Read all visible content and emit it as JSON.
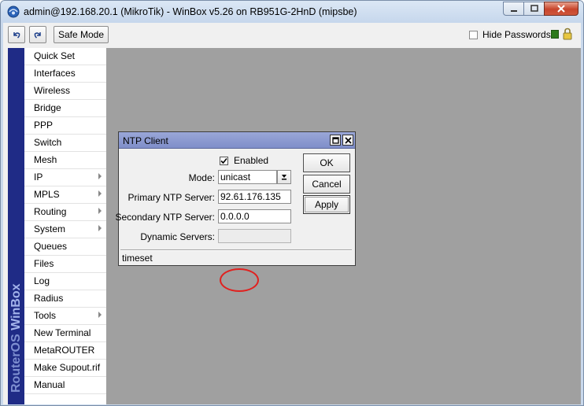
{
  "window": {
    "title": "admin@192.168.20.1 (MikroTik) - WinBox v5.26 on RB951G-2HnD (mipsbe)"
  },
  "toolbar": {
    "undo_icon": "undo-icon",
    "redo_icon": "redo-icon",
    "safe_mode_label": "Safe Mode",
    "hide_passwords_label": "Hide Passwords",
    "hide_passwords_checked": false,
    "status_color": "#2d7a1c"
  },
  "sidebar": {
    "brand": {
      "part1": "RouterOS ",
      "part2": "WinBox"
    },
    "brand_color": "#1f2b86",
    "items": [
      {
        "label": "Quick Set",
        "submenu": false
      },
      {
        "label": "Interfaces",
        "submenu": false
      },
      {
        "label": "Wireless",
        "submenu": false
      },
      {
        "label": "Bridge",
        "submenu": false
      },
      {
        "label": "PPP",
        "submenu": false
      },
      {
        "label": "Switch",
        "submenu": false
      },
      {
        "label": "Mesh",
        "submenu": false
      },
      {
        "label": "IP",
        "submenu": true
      },
      {
        "label": "MPLS",
        "submenu": true
      },
      {
        "label": "Routing",
        "submenu": true
      },
      {
        "label": "System",
        "submenu": true
      },
      {
        "label": "Queues",
        "submenu": false
      },
      {
        "label": "Files",
        "submenu": false
      },
      {
        "label": "Log",
        "submenu": false
      },
      {
        "label": "Radius",
        "submenu": false
      },
      {
        "label": "Tools",
        "submenu": true
      },
      {
        "label": "New Terminal",
        "submenu": false
      },
      {
        "label": "MetaROUTER",
        "submenu": false
      },
      {
        "label": "Make Supout.rif",
        "submenu": false
      },
      {
        "label": "Manual",
        "submenu": false
      }
    ]
  },
  "ntp_dialog": {
    "title": "NTP Client",
    "enabled_label": "Enabled",
    "enabled_checked": true,
    "mode_label": "Mode:",
    "mode_value": "unicast",
    "primary_label": "Primary NTP Server:",
    "primary_value": "92.61.176.135",
    "secondary_label": "Secondary NTP Server:",
    "secondary_value": "0.0.0.0",
    "dynamic_label": "Dynamic Servers:",
    "dynamic_value": "",
    "ok_label": "OK",
    "cancel_label": "Cancel",
    "apply_label": "Apply",
    "status": "timeset",
    "title_bar_color": "#8e9bd2"
  },
  "annotation": {
    "color": "#e0211f"
  }
}
